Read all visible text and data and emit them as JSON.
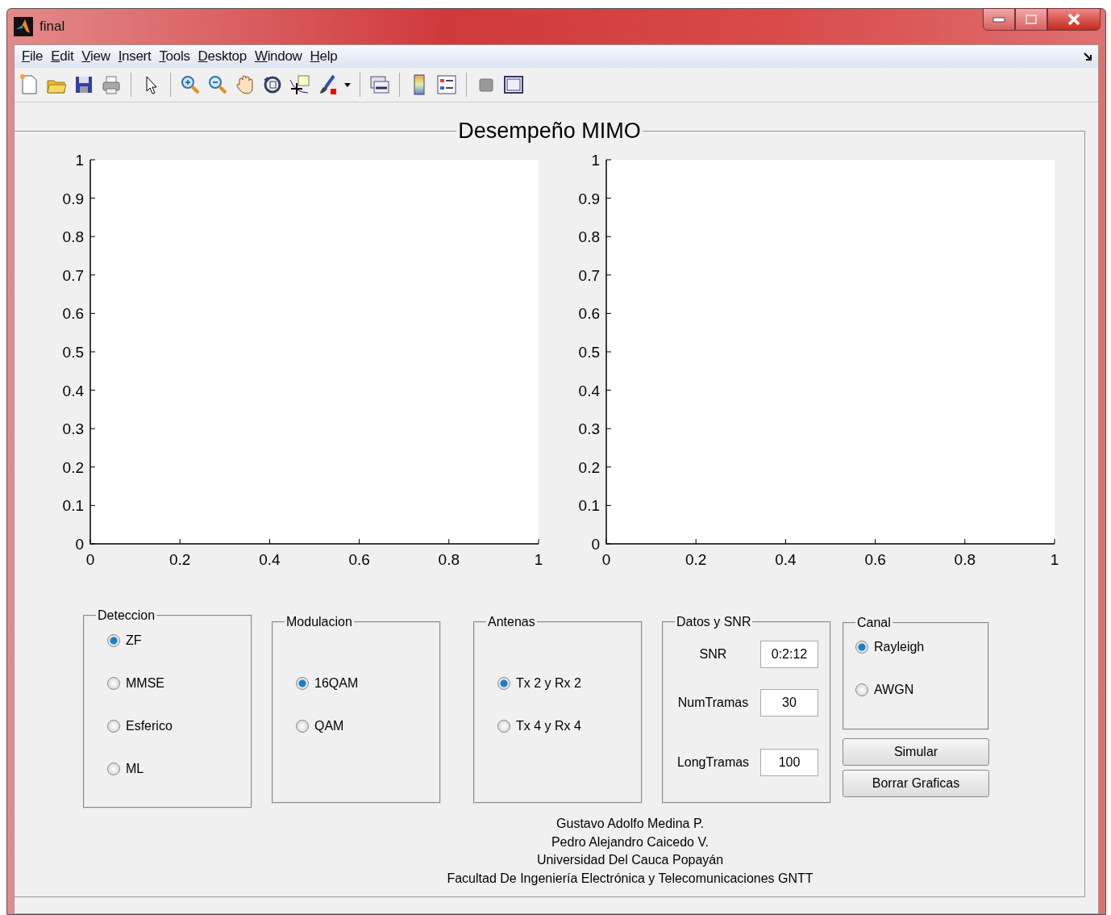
{
  "window": {
    "title": "final"
  },
  "menu": [
    {
      "label": "File"
    },
    {
      "label": "Edit"
    },
    {
      "label": "View"
    },
    {
      "label": "Insert"
    },
    {
      "label": "Tools"
    },
    {
      "label": "Desktop"
    },
    {
      "label": "Window"
    },
    {
      "label": "Help"
    }
  ],
  "panel": {
    "title": "Desempeño MIMO"
  },
  "axes": [
    {
      "chart_data": {
        "type": "line",
        "xlim": [
          0,
          1
        ],
        "ylim": [
          0,
          1
        ],
        "xticks": [
          0,
          0.2,
          0.4,
          0.6,
          0.8,
          1
        ],
        "yticks": [
          0,
          0.1,
          0.2,
          0.3,
          0.4,
          0.5,
          0.6,
          0.7,
          0.8,
          0.9,
          1
        ]
      }
    },
    {
      "chart_data": {
        "type": "line",
        "xlim": [
          0,
          1
        ],
        "ylim": [
          0,
          1
        ],
        "xticks": [
          0,
          0.2,
          0.4,
          0.6,
          0.8,
          1
        ],
        "yticks": [
          0,
          0.1,
          0.2,
          0.3,
          0.4,
          0.5,
          0.6,
          0.7,
          0.8,
          0.9,
          1
        ]
      }
    }
  ],
  "groups": [
    {
      "title": "Deteccion",
      "kind": "radio",
      "options": [
        {
          "label": "ZF",
          "selected": true
        },
        {
          "label": "MMSE",
          "selected": false
        },
        {
          "label": "Esferico",
          "selected": false
        },
        {
          "label": "ML",
          "selected": false
        }
      ]
    },
    {
      "title": "Modulacion",
      "kind": "radio",
      "options": [
        {
          "label": "16QAM",
          "selected": true
        },
        {
          "label": "QAM",
          "selected": false
        }
      ]
    },
    {
      "title": "Antenas",
      "kind": "radio",
      "options": [
        {
          "label": "Tx 2 y Rx 2",
          "selected": true
        },
        {
          "label": "Tx 4 y Rx 4",
          "selected": false
        }
      ]
    },
    {
      "title": "Datos y SNR",
      "kind": "fields",
      "fields": [
        {
          "label": "SNR",
          "value": "0:2:12"
        },
        {
          "label": "NumTramas",
          "value": "30"
        },
        {
          "label": "LongTramas",
          "value": "100"
        }
      ]
    },
    {
      "title": "Canal",
      "kind": "radio",
      "options": [
        {
          "label": "Rayleigh",
          "selected": true
        },
        {
          "label": "AWGN",
          "selected": false
        }
      ],
      "buttons": [
        "Simular",
        "Borrar Graficas"
      ]
    }
  ],
  "credits": [
    "Gustavo Adolfo Medina P.",
    "Pedro Alejandro Caicedo V.",
    "Universidad Del Cauca Popayán",
    "Facultad De Ingeniería Electrónica y Telecomunicaciones GNTT"
  ]
}
